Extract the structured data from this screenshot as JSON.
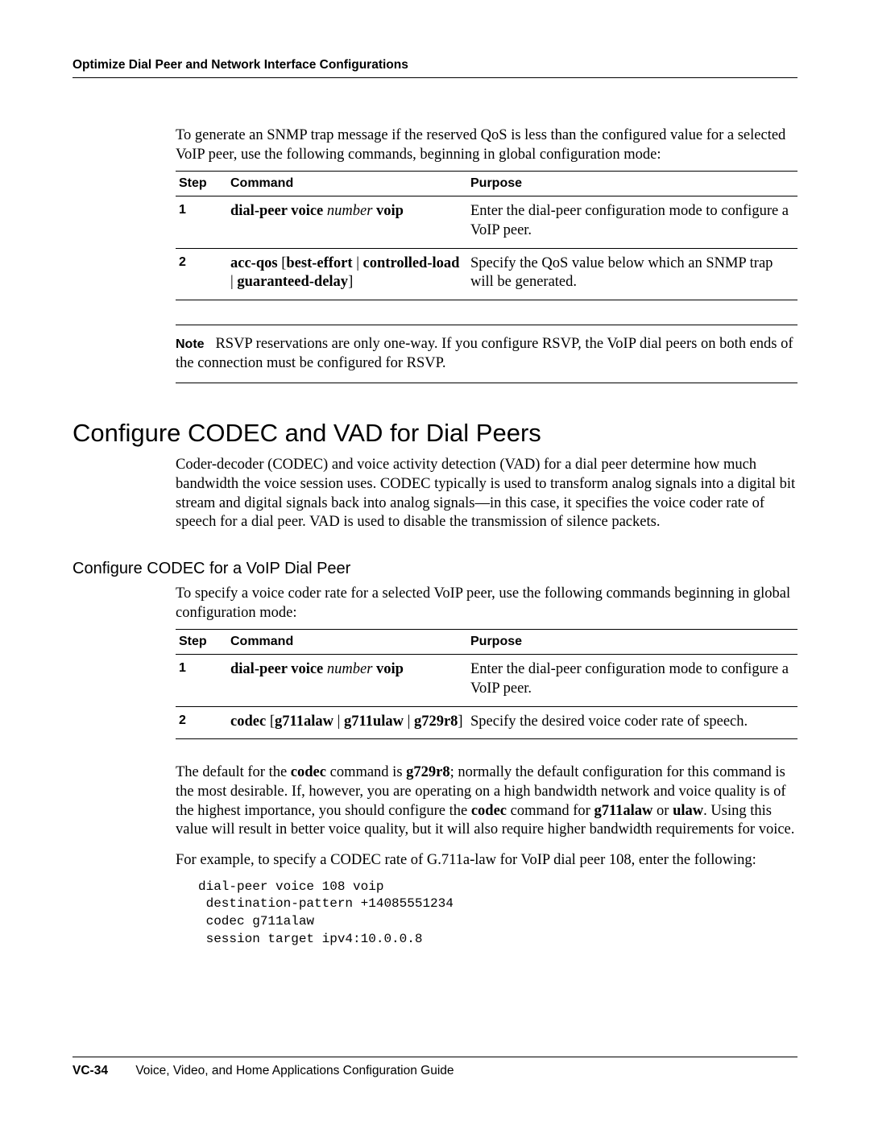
{
  "running_head": "Optimize Dial Peer and Network Interface Configurations",
  "intro_para": "To generate an SNMP trap message if the reserved QoS is less than the configured value for a selected VoIP peer, use the following commands, beginning in global configuration mode:",
  "tbl1": {
    "h_step": "Step",
    "h_cmd": "Command",
    "h_purpose": "Purpose",
    "r1": {
      "step": "1",
      "cmd_b1": "dial-peer voice",
      "cmd_it": "number",
      "cmd_b2": "voip",
      "purpose": "Enter the dial-peer configuration mode to configure a VoIP peer."
    },
    "r2": {
      "step": "2",
      "cmd_b1": "acc-qos",
      "cmd_plain": " [",
      "cmd_b2": "best-effort",
      "cmd_plain2": " | ",
      "cmd_b3": "controlled-load",
      "cmd_plain3": " | ",
      "cmd_b4": "guaranteed-delay",
      "cmd_plain4": "]",
      "purpose": "Specify the QoS value below which an SNMP trap will be generated."
    }
  },
  "note_label": "Note",
  "note_text": "RSVP reservations are only one-way. If you configure RSVP, the VoIP dial peers on both ends of the connection must be configured for RSVP.",
  "h1": "Configure CODEC and VAD for Dial Peers",
  "h1_para": "Coder-decoder (CODEC) and voice activity detection (VAD) for a dial peer determine how much bandwidth the voice session uses. CODEC typically is used to transform analog signals into a digital bit stream and digital signals back into analog signals—in this case, it specifies the voice coder rate of speech for a dial peer. VAD is used to disable the transmission of silence packets.",
  "h2": "Configure CODEC for a VoIP Dial Peer",
  "h2_para": "To specify a voice coder rate for a selected VoIP peer, use the following commands beginning in global configuration mode:",
  "tbl2": {
    "h_step": "Step",
    "h_cmd": "Command",
    "h_purpose": "Purpose",
    "r1": {
      "step": "1",
      "cmd_b1": "dial-peer voice",
      "cmd_it": "number",
      "cmd_b2": "voip",
      "purpose": "Enter the dial-peer configuration mode to configure a VoIP peer."
    },
    "r2": {
      "step": "2",
      "cmd_b1": "codec",
      "cmd_plain": " [",
      "cmd_b2": "g711alaw",
      "cmd_plain2": " | ",
      "cmd_b3": "g711ulaw",
      "cmd_plain3": " | ",
      "cmd_b4": "g729r8",
      "cmd_plain4": "]",
      "purpose": "Specify the desired voice coder rate of speech."
    }
  },
  "para_default": {
    "t1": "The default for the ",
    "b1": "codec",
    "t2": " command is ",
    "b2": "g729r8",
    "t3": "; normally the default configuration for this command is the most desirable. If, however, you are operating on a high bandwidth network and voice quality is of the highest importance, you should configure the ",
    "b3": "codec",
    "t4": " command for ",
    "b4": "g711alaw",
    "t5": " or ",
    "b5": "ulaw",
    "t6": ". Using this value will result in better voice quality, but it will also require higher bandwidth requirements for voice."
  },
  "para_example": "For example, to specify a CODEC rate of G.711a-law for VoIP dial peer 108, enter the following:",
  "code": "dial-peer voice 108 voip\n destination-pattern +14085551234\n codec g711alaw\n session target ipv4:10.0.0.8",
  "footer_page": "VC-34",
  "footer_title": "Voice, Video, and Home Applications Configuration Guide"
}
